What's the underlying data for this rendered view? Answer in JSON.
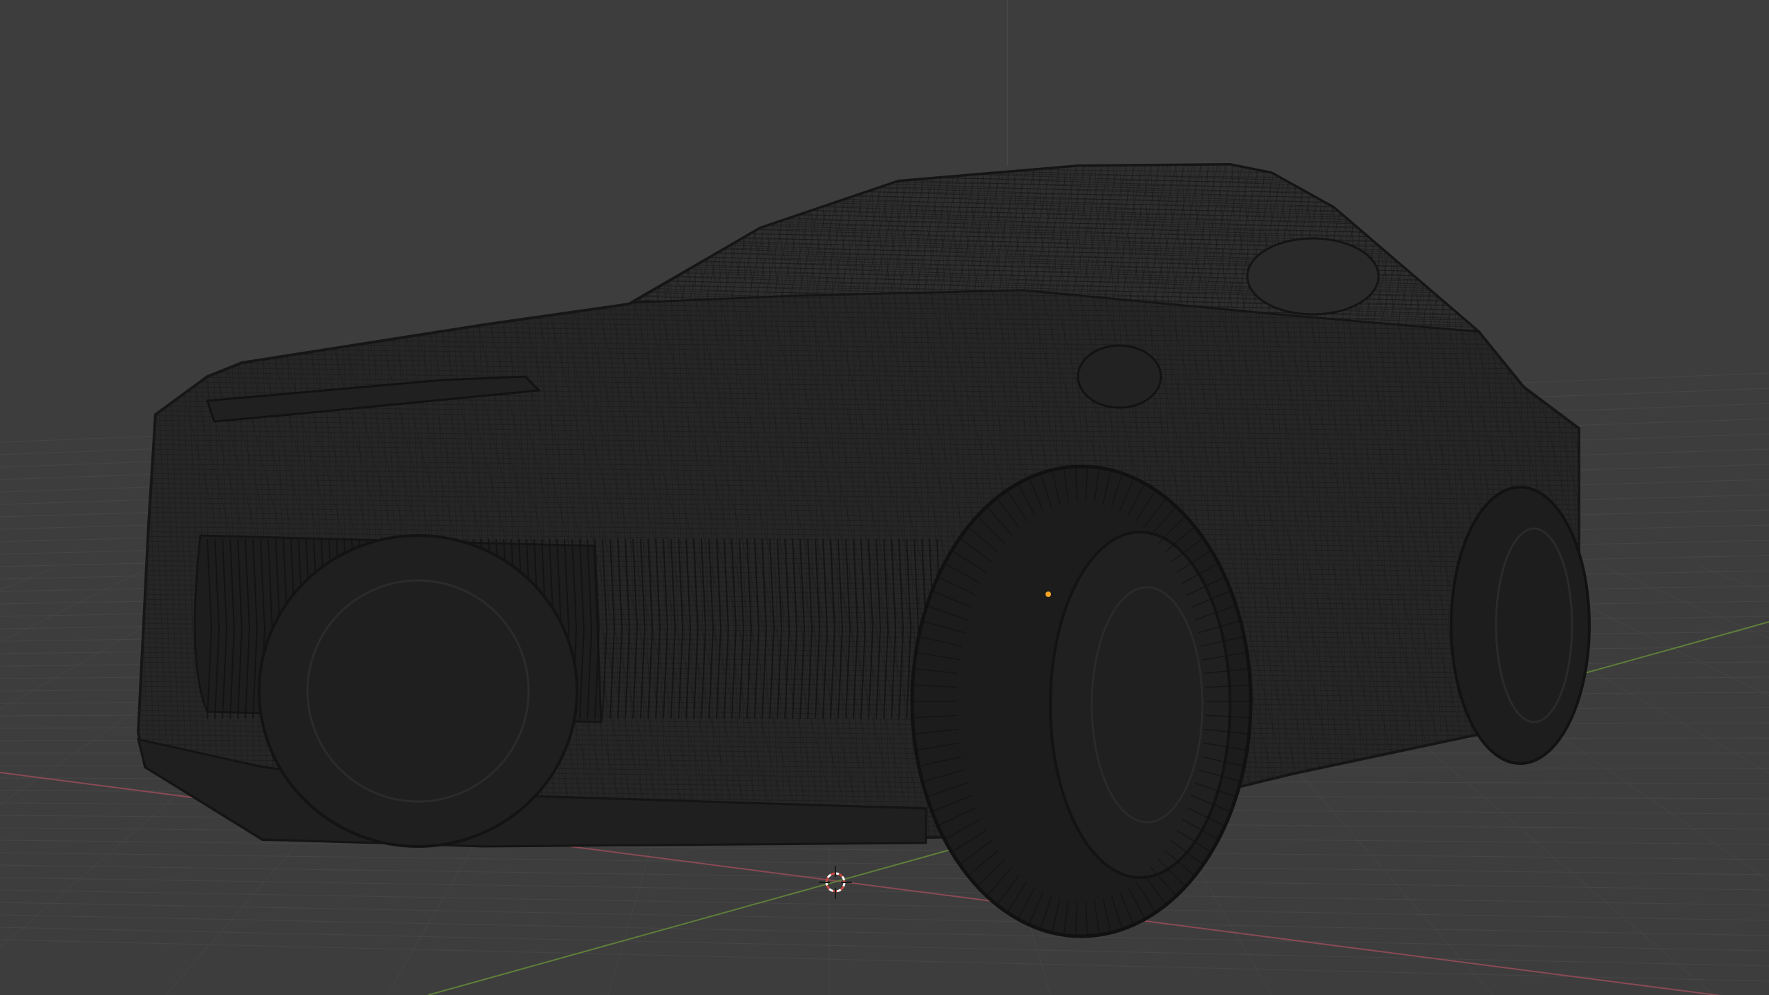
{
  "viewport": {
    "shading": "wireframe",
    "background_color": "#3d3d3d",
    "grid_color": "#474747",
    "x_axis_color": "#8a4a55",
    "y_axis_color": "#5f7f3a",
    "wire_color": "#1a1a1a",
    "origin_dot_color": "#f5a623",
    "cursor_colors": [
      "#c8483e",
      "#ffffff"
    ]
  },
  "object": {
    "name_icon": "car-mesh-icon"
  }
}
